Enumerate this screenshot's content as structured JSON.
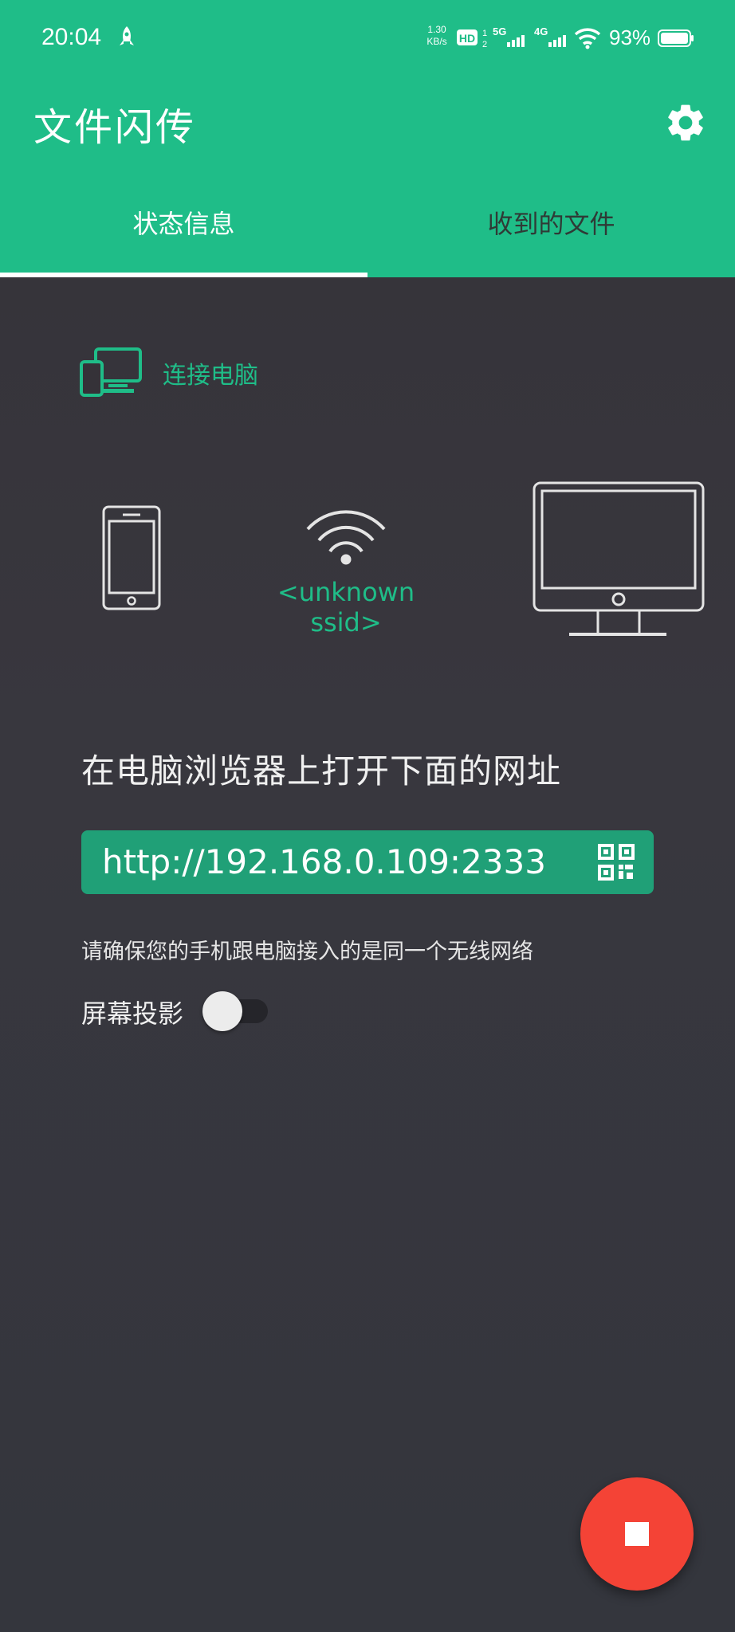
{
  "status_bar": {
    "time": "20:04",
    "app_icon": "rocket-icon",
    "net_speed_value": "1.30",
    "net_speed_unit": "KB/s",
    "hd_badge": "HD",
    "signal_5g": "5G",
    "signal_4g": "4G",
    "battery_percent": "93%"
  },
  "app_bar": {
    "title": "文件闪传",
    "settings_icon": "gear-icon"
  },
  "tabs": [
    {
      "label": "状态信息",
      "selected": true
    },
    {
      "label": "收到的文件",
      "selected": false
    }
  ],
  "connect": {
    "icon": "devices-icon",
    "label": "连接电脑"
  },
  "network": {
    "ssid": "<unknown ssid>"
  },
  "instruction": "在电脑浏览器上打开下面的网址",
  "url": "http://192.168.0.109:2333",
  "qr_icon": "qr-code-icon",
  "hint": "请确保您的手机跟电脑接入的是同一个无线网络",
  "screen_mirror": {
    "label": "屏幕投影",
    "enabled": false
  },
  "fab": {
    "icon": "stop-icon"
  },
  "colors": {
    "accent": "#1fbd88",
    "background": "#36353b",
    "url_box": "#20a077",
    "fab": "#f44336"
  }
}
